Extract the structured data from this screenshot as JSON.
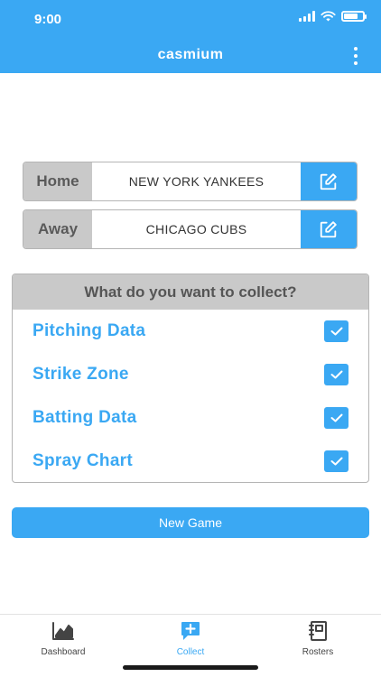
{
  "status_bar": {
    "time": "9:00",
    "signal_icon": "cellular-signal-icon",
    "wifi_icon": "wifi-icon",
    "battery_icon": "battery-icon"
  },
  "header": {
    "title": "casmium",
    "menu_icon": "more-vertical-icon",
    "color": "#3aa8f3"
  },
  "teams": [
    {
      "label": "Home",
      "name": "NEW YORK YANKEES",
      "edit_icon": "edit-icon"
    },
    {
      "label": "Away",
      "name": "CHICAGO CUBS",
      "edit_icon": "edit-icon"
    }
  ],
  "collect": {
    "heading": "What do you want to collect?",
    "options": [
      {
        "label": "Pitching Data",
        "checked": true
      },
      {
        "label": "Strike Zone",
        "checked": true
      },
      {
        "label": "Batting Data",
        "checked": true
      },
      {
        "label": "Spray Chart",
        "checked": true
      }
    ]
  },
  "new_game_label": "New Game",
  "tabs": [
    {
      "label": "Dashboard",
      "icon": "chart-icon",
      "active": false
    },
    {
      "label": "Collect",
      "icon": "add-message-icon",
      "active": true
    },
    {
      "label": "Rosters",
      "icon": "notebook-icon",
      "active": false
    }
  ]
}
